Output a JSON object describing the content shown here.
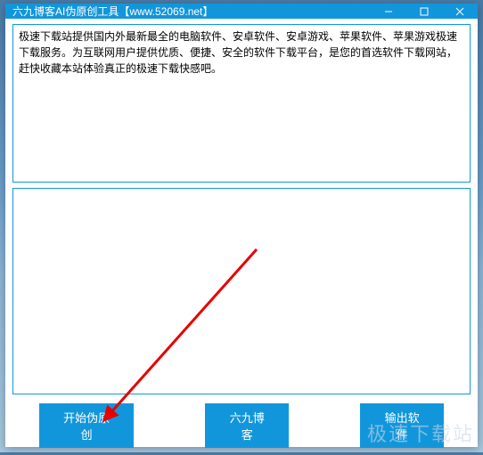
{
  "titlebar": {
    "title": "六九博客AI伪原创工具【www.52069.net】"
  },
  "input": {
    "text": "极速下载站提供国内外最新最全的电脑软件、安卓软件、安卓游戏、苹果软件、苹果游戏极速下载服务。为互联网用户提供优质、便捷、安全的软件下载平台，是您的首选软件下载网站，赶快收藏本站体验真正的极速下载快感吧。"
  },
  "output": {
    "text": ""
  },
  "buttons": {
    "start": "开始伪原创",
    "blog": "六九博客",
    "export": "输出软件"
  },
  "watermark": "极速下载站"
}
